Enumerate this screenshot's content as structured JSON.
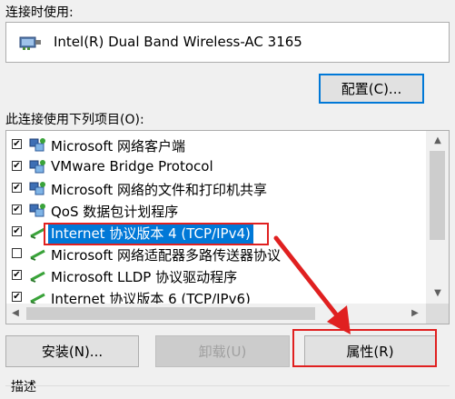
{
  "section_connect_using": "连接时使用:",
  "adapter": {
    "name": "Intel(R) Dual Band Wireless-AC 3165",
    "icon": "network-adapter-icon"
  },
  "configure_button": "配置(C)...",
  "section_items": "此连接使用下列项目(O):",
  "items": [
    {
      "label": "Microsoft 网络客户端",
      "checked": true,
      "icon": "network-client-icon"
    },
    {
      "label": "VMware Bridge Protocol",
      "checked": true,
      "icon": "network-service-icon"
    },
    {
      "label": "Microsoft 网络的文件和打印机共享",
      "checked": true,
      "icon": "network-service-icon"
    },
    {
      "label": "QoS 数据包计划程序",
      "checked": true,
      "icon": "network-service-icon"
    },
    {
      "label": "Internet 协议版本 4 (TCP/IPv4)",
      "checked": true,
      "icon": "protocol-icon",
      "selected": true
    },
    {
      "label": "Microsoft 网络适配器多路传送器协议",
      "checked": false,
      "icon": "protocol-icon"
    },
    {
      "label": "Microsoft LLDP 协议驱动程序",
      "checked": true,
      "icon": "protocol-icon"
    },
    {
      "label": "Internet 协议版本 6 (TCP/IPv6)",
      "checked": true,
      "icon": "protocol-icon"
    }
  ],
  "buttons": {
    "install": "安装(N)...",
    "uninstall": "卸载(U)",
    "properties": "属性(R)"
  },
  "section_description": "描述",
  "colors": {
    "selection": "#0078d7",
    "annotation": "#e02020",
    "focus": "#0078d7"
  }
}
